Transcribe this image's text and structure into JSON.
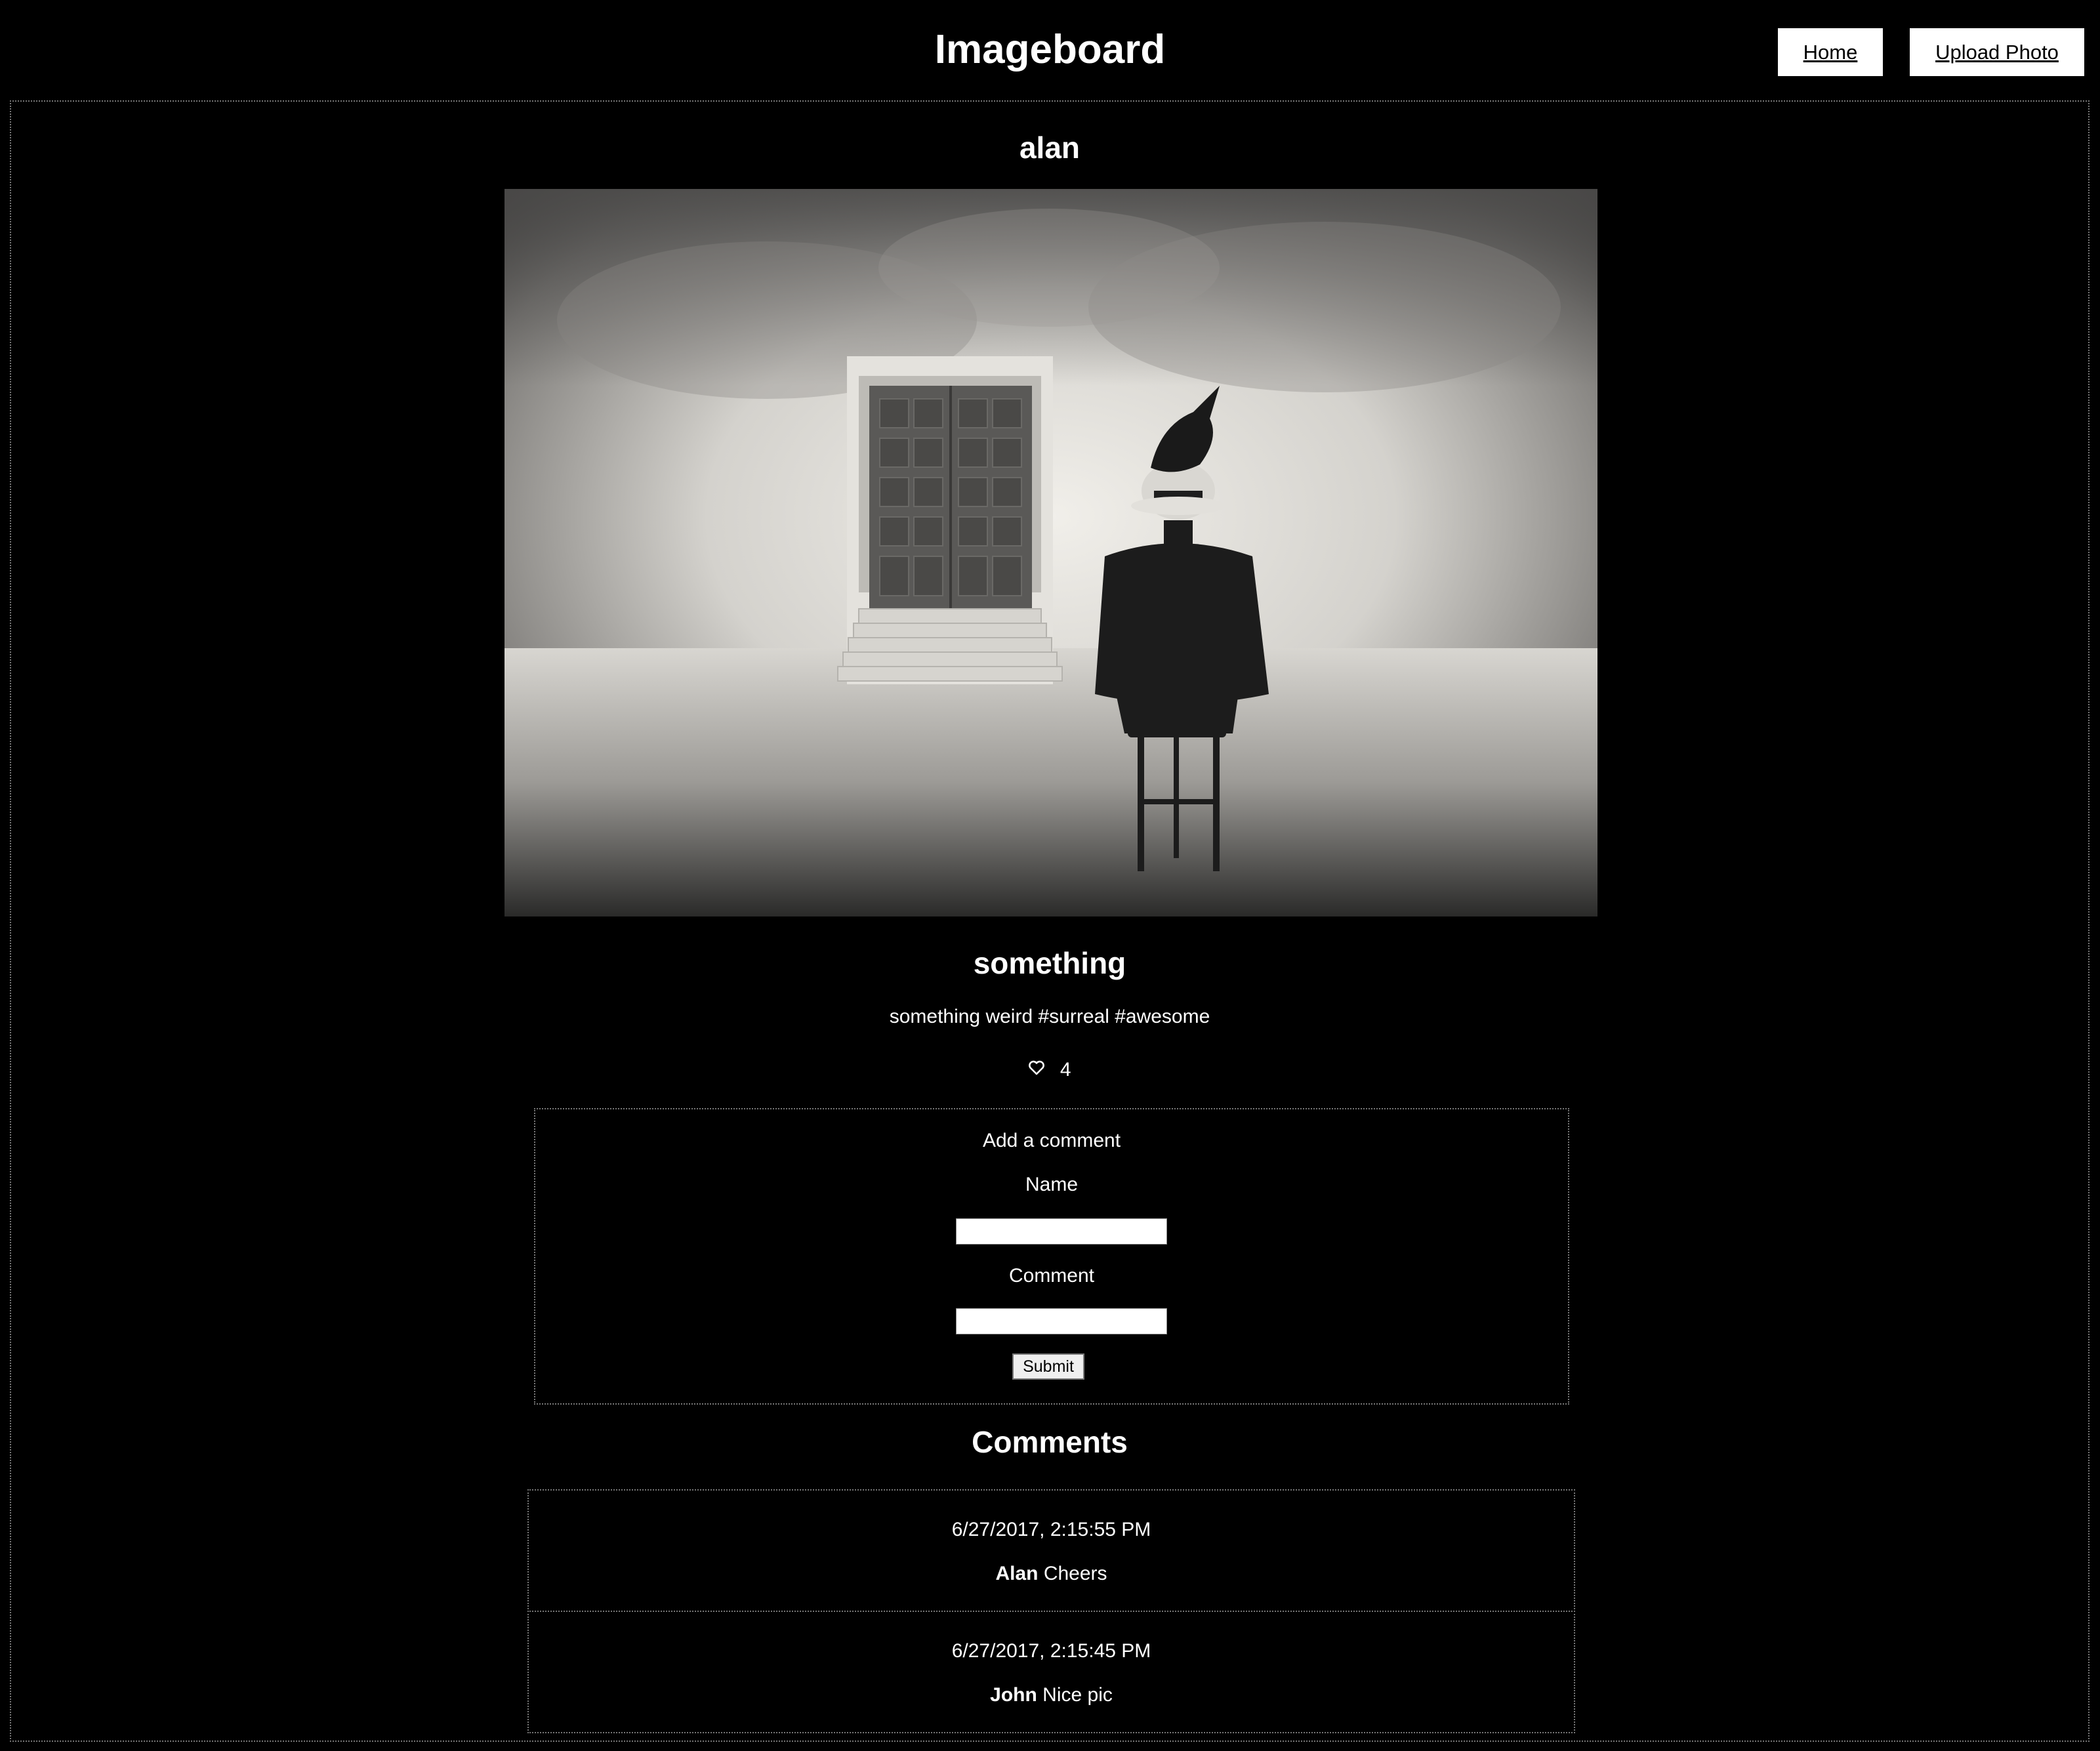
{
  "header": {
    "title": "Imageboard",
    "nav": {
      "home_label": "Home",
      "upload_label": "Upload Photo"
    }
  },
  "post": {
    "username": "alan",
    "title": "something",
    "description": "something weird #surreal #awesome",
    "likes": "4",
    "like_icon": "heart-icon"
  },
  "comment_form": {
    "heading": "Add a comment",
    "name_label": "Name",
    "name_value": "",
    "comment_label": "Comment",
    "comment_value": "",
    "submit_label": "Submit"
  },
  "comments": {
    "heading": "Comments",
    "items": [
      {
        "timestamp": "6/27/2017, 2:15:55 PM",
        "author": "Alan",
        "text": "Cheers"
      },
      {
        "timestamp": "6/27/2017, 2:15:45 PM",
        "author": "John",
        "text": "Nice pic"
      }
    ]
  },
  "colors": {
    "background": "#000000",
    "text": "#ffffff",
    "button_bg": "#ffffff",
    "border": "#777777"
  }
}
